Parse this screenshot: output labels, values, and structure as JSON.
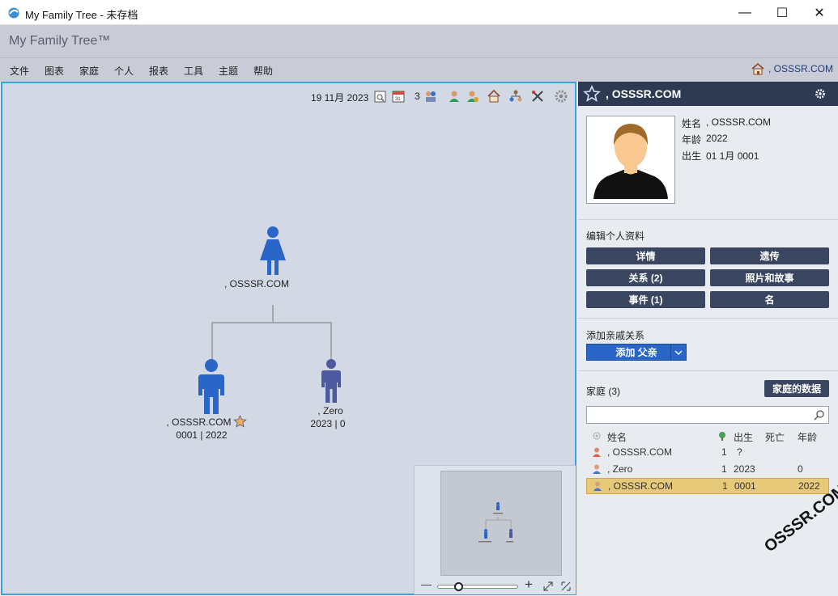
{
  "window": {
    "title": "My Family Tree - 未存档",
    "minimize": "—",
    "maximize": "☐",
    "close": "✕"
  },
  "app": {
    "title": "My Family Tree™"
  },
  "menu": {
    "items": [
      "文件",
      "图表",
      "家庭",
      "个人",
      "报表",
      "工具",
      "主题",
      "帮助"
    ],
    "home_person": ", OSSSR.COM"
  },
  "toolbar": {
    "date": "19 11月 2023",
    "generations": "3"
  },
  "tree": {
    "mother": {
      "name": ", OSSSR.COM"
    },
    "person": {
      "name": ", OSSSR.COM",
      "dates": "0001 | 2022"
    },
    "child": {
      "name": ", Zero",
      "dates": "2023 | 0"
    }
  },
  "zoom": {
    "minus": "—",
    "plus": "+",
    "level": 0.25
  },
  "panel": {
    "header_name": ", OSSSR.COM",
    "name_label": "姓名",
    "name_value": ", OSSSR.COM",
    "age_label": "年龄",
    "age_value": "2022",
    "birth_label": "出生",
    "birth_value": "01 1月 0001",
    "edit_section": "编辑个人资料",
    "buttons": {
      "details": "详情",
      "genetics": "遗传",
      "relations": "关系 (2)",
      "photos": "照片和故事",
      "events": "事件 (1)",
      "names": "名"
    },
    "add_section": "添加亲戚关系",
    "add_button": "添加 父亲",
    "family_label": "家庭 (3)",
    "family_data_button": "家庭的数据",
    "search_placeholder": "",
    "columns": {
      "name": "姓名",
      "born": "出生",
      "died": "死亡",
      "age": "年龄"
    },
    "rows": [
      {
        "name": ", OSSSR.COM",
        "gen": "1",
        "born": "?",
        "died": "",
        "age": ""
      },
      {
        "name": ", Zero",
        "gen": "1",
        "born": "2023",
        "died": "",
        "age": "0"
      },
      {
        "name": ", OSSSR.COM",
        "gen": "1",
        "born": "0001",
        "died": "",
        "age": "2022"
      }
    ]
  },
  "watermark": "OSSSR.COM",
  "colors": {
    "accent": "#3aa3d8",
    "male": "#2a66c8",
    "child": "#4e5aa0",
    "panel_header": "#2e3a52",
    "selected_row": "#e7c97a"
  }
}
